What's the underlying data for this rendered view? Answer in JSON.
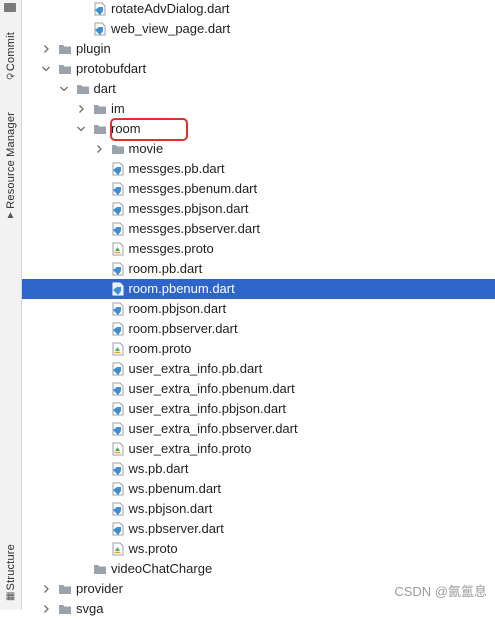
{
  "sidebar": {
    "tabs": [
      {
        "label": "Commit",
        "icon": "commit-icon"
      },
      {
        "label": "Resource Manager",
        "icon": "resource-manager-icon"
      },
      {
        "label": "Structure",
        "icon": "structure-icon"
      }
    ]
  },
  "tree": {
    "rows": [
      {
        "label": "rotateAdvDialog.dart",
        "type": "dart-file",
        "depth": 4
      },
      {
        "label": "web_view_page.dart",
        "type": "dart-file",
        "depth": 4
      },
      {
        "label": "plugin",
        "type": "folder",
        "depth": 2,
        "expanded": false
      },
      {
        "label": "protobufdart",
        "type": "folder",
        "depth": 2,
        "expanded": true
      },
      {
        "label": "dart",
        "type": "folder",
        "depth": 3,
        "expanded": true
      },
      {
        "label": "im",
        "type": "folder",
        "depth": 4,
        "expanded": false
      },
      {
        "label": "room",
        "type": "folder",
        "depth": 4,
        "expanded": true,
        "highlighted": true
      },
      {
        "label": "movie",
        "type": "folder",
        "depth": 5,
        "expanded": false
      },
      {
        "label": "messges.pb.dart",
        "type": "dart-file",
        "depth": 5
      },
      {
        "label": "messges.pbenum.dart",
        "type": "dart-file",
        "depth": 5
      },
      {
        "label": "messges.pbjson.dart",
        "type": "dart-file",
        "depth": 5
      },
      {
        "label": "messges.pbserver.dart",
        "type": "dart-file",
        "depth": 5
      },
      {
        "label": "messges.proto",
        "type": "proto-file",
        "depth": 5
      },
      {
        "label": "room.pb.dart",
        "type": "dart-file",
        "depth": 5
      },
      {
        "label": "room.pbenum.dart",
        "type": "dart-file",
        "depth": 5,
        "selected": true
      },
      {
        "label": "room.pbjson.dart",
        "type": "dart-file",
        "depth": 5
      },
      {
        "label": "room.pbserver.dart",
        "type": "dart-file",
        "depth": 5
      },
      {
        "label": "room.proto",
        "type": "proto-file",
        "depth": 5
      },
      {
        "label": "user_extra_info.pb.dart",
        "type": "dart-file",
        "depth": 5
      },
      {
        "label": "user_extra_info.pbenum.dart",
        "type": "dart-file",
        "depth": 5
      },
      {
        "label": "user_extra_info.pbjson.dart",
        "type": "dart-file",
        "depth": 5
      },
      {
        "label": "user_extra_info.pbserver.dart",
        "type": "dart-file",
        "depth": 5
      },
      {
        "label": "user_extra_info.proto",
        "type": "proto-file",
        "depth": 5
      },
      {
        "label": "ws.pb.dart",
        "type": "dart-file",
        "depth": 5
      },
      {
        "label": "ws.pbenum.dart",
        "type": "dart-file",
        "depth": 5
      },
      {
        "label": "ws.pbjson.dart",
        "type": "dart-file",
        "depth": 5
      },
      {
        "label": "ws.pbserver.dart",
        "type": "dart-file",
        "depth": 5
      },
      {
        "label": "ws.proto",
        "type": "proto-file",
        "depth": 5
      },
      {
        "label": "videoChatCharge",
        "type": "folder",
        "depth": 4,
        "leaf": true
      },
      {
        "label": "provider",
        "type": "folder",
        "depth": 2,
        "expanded": false
      },
      {
        "label": "svga",
        "type": "folder",
        "depth": 2,
        "expanded": false
      }
    ]
  },
  "watermark": "CSDN @氤氲息",
  "colors": {
    "selection": "#2f65ca",
    "highlight_box": "#e0302a",
    "folder": "#9aa3ad",
    "dart_icon": "#3d8fd6",
    "proto_icon": "#4caf50"
  }
}
